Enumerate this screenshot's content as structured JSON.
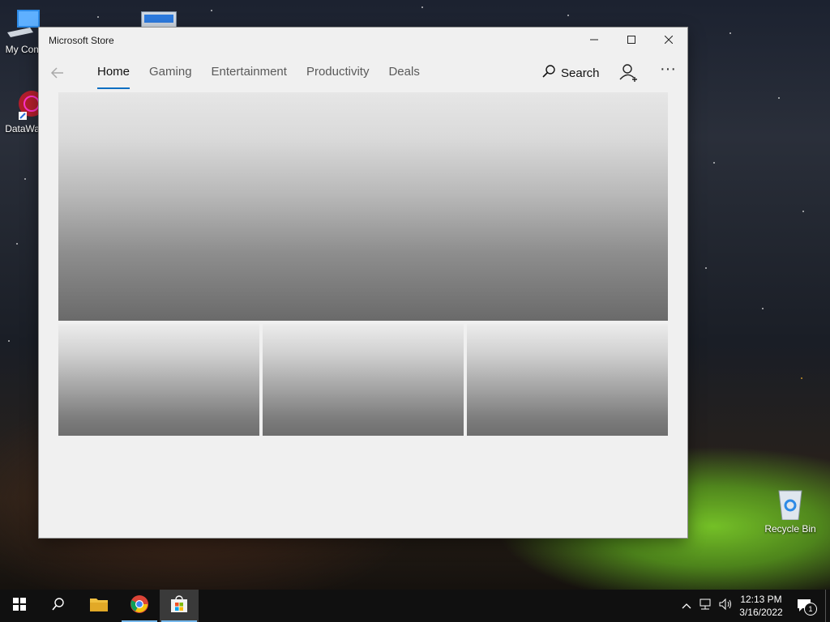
{
  "desktop": {
    "icons": [
      {
        "label": "My Com",
        "icon": "computer-icon"
      },
      {
        "label": "DataWag",
        "icon": "datawag-app-icon"
      },
      {
        "label": "Recycle Bin",
        "icon": "recycle-bin-icon"
      }
    ]
  },
  "window": {
    "title": "Microsoft Store",
    "caption": {
      "minimize": "minimize-icon",
      "maximize": "maximize-icon",
      "close": "close-icon"
    }
  },
  "nav": {
    "back_icon": "back-arrow-icon",
    "tabs": [
      {
        "label": "Home",
        "active": true
      },
      {
        "label": "Gaming",
        "active": false
      },
      {
        "label": "Entertainment",
        "active": false
      },
      {
        "label": "Productivity",
        "active": false
      },
      {
        "label": "Deals",
        "active": false
      }
    ],
    "search_label": "Search",
    "account_icon": "account-add-icon",
    "more_label": "···"
  },
  "colors": {
    "accent": "#0a6fc2",
    "taskbar": "#101010",
    "window_bg": "#f0f0f0"
  },
  "taskbar": {
    "items": [
      "start-icon",
      "search-icon",
      "file-explorer-icon",
      "chrome-icon",
      "microsoft-store-icon"
    ],
    "active_item": "microsoft-store-icon",
    "tray": [
      "chevron-up-icon",
      "network-icon",
      "volume-icon"
    ],
    "time": "12:13 PM",
    "date": "3/16/2022",
    "notification_count": "1"
  }
}
